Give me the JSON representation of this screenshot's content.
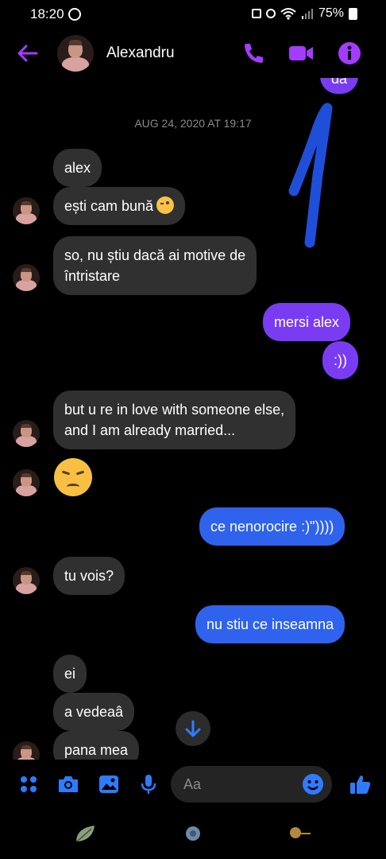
{
  "status_bar": {
    "time": "18:20",
    "battery": "75%"
  },
  "header": {
    "contact_name": "Alexandru"
  },
  "conversation": {
    "date_divider": "AUG 24, 2020 AT 19:17",
    "top_partial": "da",
    "messages": [
      {
        "from": "them",
        "text": "alex"
      },
      {
        "from": "them",
        "text": "ești cam bună"
      },
      {
        "from": "them",
        "lines": [
          "so, nu știu dacă ai motive de",
          "întristare"
        ]
      },
      {
        "from": "me",
        "text": "mersi alex"
      },
      {
        "from": "me",
        "text": ":))"
      },
      {
        "from": "them",
        "lines": [
          "but u re in love with someone else,",
          "and I am already married..."
        ]
      },
      {
        "from": "them",
        "emoji": "disappointed-face"
      },
      {
        "from": "me",
        "text": "ce nenorocire :)\"))))"
      },
      {
        "from": "them",
        "text": "tu vois?"
      },
      {
        "from": "me",
        "text": "nu stiu ce inseamna"
      },
      {
        "from": "them",
        "text": "ei"
      },
      {
        "from": "them",
        "text": "a vedeaâ"
      },
      {
        "from": "them",
        "text": "pana mea"
      }
    ]
  },
  "composer": {
    "placeholder": "Aa"
  },
  "colors": {
    "accent": "#9b35ff",
    "sent_purple": "#7a3cf2",
    "sent_blue": "#2f63ee",
    "received": "#303030",
    "ink": "#1f4fd8"
  },
  "icons": [
    "back-arrow-icon",
    "phone-icon",
    "video-icon",
    "info-icon",
    "apps-icon",
    "camera-icon",
    "gallery-icon",
    "microphone-icon",
    "emoji-icon",
    "like-icon",
    "scroll-down-icon"
  ]
}
